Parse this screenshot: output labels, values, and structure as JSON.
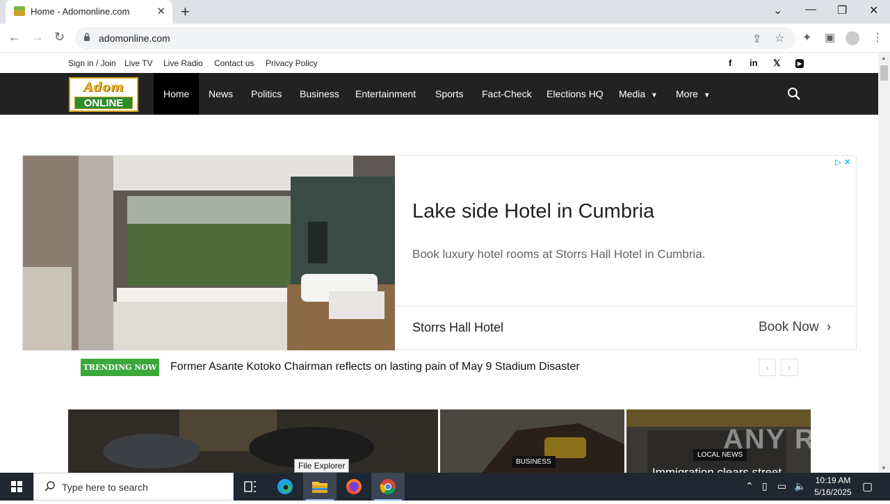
{
  "browser": {
    "tab_title": "Home - Adomonline.com",
    "url": "adomonline.com"
  },
  "site": {
    "top_links": [
      "Sign in / Join",
      "Live TV",
      "Live Radio",
      "Contact us",
      "Privacy Policy"
    ],
    "social_icons": [
      "facebook-icon",
      "linkedin-icon",
      "x-icon",
      "youtube-icon"
    ],
    "logo": {
      "line1": "Adom",
      "line2": "ONLINE"
    },
    "nav": [
      "Home",
      "News",
      "Politics",
      "Business",
      "Entertainment",
      "Sports",
      "Fact-Check",
      "Elections HQ",
      "Media",
      "More"
    ],
    "nav_active": "Home"
  },
  "ad": {
    "headline": "Lake side Hotel in Cumbria",
    "description": "Book luxury hotel rooms at Storrs Hall Hotel in Cumbria.",
    "brand": "Storrs Hall Hotel",
    "cta": "Book Now"
  },
  "trending": {
    "badge": "TRENDING NOW",
    "headline": "Former Asante Kotoko Chairman reflects on lasting pain of May 9 Stadium Disaster"
  },
  "tiles": [
    {
      "category": ""
    },
    {
      "category": "BUSINESS"
    },
    {
      "category": "LOCAL NEWS",
      "title": "Immigration clears street"
    }
  ],
  "watermark": "ANY RUN",
  "tooltip": "File Explorer",
  "taskbar": {
    "search_placeholder": "Type here to search",
    "time": "10:19 AM",
    "date": "5/16/2025"
  },
  "colors": {
    "nav_bg": "#222222",
    "trending_green": "#3aa83a",
    "ad_choices": "#00aecd",
    "taskbar_bg": "#1f2732"
  }
}
